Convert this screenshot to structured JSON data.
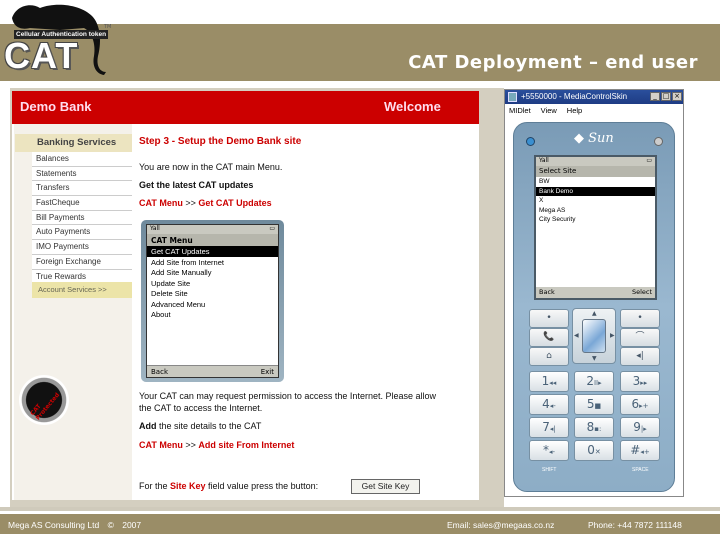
{
  "slide": {
    "title": "CAT Deployment – end user",
    "logo": {
      "tagline": "Cellular Authentication token",
      "wordmark": "CAT",
      "trademark": "TM"
    }
  },
  "bank": {
    "name": "Demo Bank",
    "welcome": "Welcome",
    "sidebar": {
      "heading": "Banking Services",
      "items": [
        {
          "label": "Balances"
        },
        {
          "label": "Statements"
        },
        {
          "label": "Transfers"
        },
        {
          "label": "FastCheque"
        },
        {
          "label": "Bill Payments"
        },
        {
          "label": "Auto Payments"
        },
        {
          "label": "IMO Payments"
        },
        {
          "label": "Foreign Exchange"
        },
        {
          "label": "True Rewards"
        }
      ],
      "footer_link": "Account Services  >>",
      "badge_text": "CAT Protected"
    },
    "content": {
      "step_title": "Step 3 - Setup the Demo Bank site",
      "intro": "You are now in the CAT main Menu.",
      "get_updates_heading": "Get the latest CAT updates",
      "path1_menu": "CAT Menu",
      "path1_sep": " >> ",
      "path1_target": "Get CAT Updates",
      "permission_line1": "Your CAT can may request permission to access the Internet. Please allow",
      "permission_line2": "the CAT to access the Internet.",
      "add_site_bold": "Add",
      "add_site_rest": " the site details to the CAT",
      "path2_menu": "CAT Menu",
      "path2_sep": " >> ",
      "path2_target": "Add site From Internet",
      "sitekey_prefix": "For the ",
      "sitekey_label": "Site Key",
      "sitekey_suffix": " field value press the button:",
      "sitekey_button": "Get Site Key"
    },
    "mini_phone": {
      "status_left": "Yall",
      "status_right": "▭",
      "title": "CAT Menu",
      "items": [
        {
          "label": "Get CAT Updates",
          "selected": true
        },
        {
          "label": "Add Site from Internet",
          "selected": false
        },
        {
          "label": "Add Site Manually",
          "selected": false
        },
        {
          "label": "Update Site",
          "selected": false
        },
        {
          "label": "Delete Site",
          "selected": false
        },
        {
          "label": "Advanced Menu",
          "selected": false
        },
        {
          "label": "About",
          "selected": false
        }
      ],
      "soft_left": "Back",
      "soft_right": "Exit"
    }
  },
  "emulator": {
    "window_title": "+5550000 - MediaControlSkin",
    "window_buttons": [
      "_",
      "□",
      "×"
    ],
    "menu": [
      "MIDlet",
      "View",
      "Help"
    ],
    "brand": "Sun",
    "screen": {
      "status_left": "Yall",
      "status_right": "▭",
      "title": "Select Site",
      "items": [
        {
          "label": "BW",
          "selected": false
        },
        {
          "label": "Bank Demo",
          "selected": true
        },
        {
          "label": "X",
          "selected": false
        },
        {
          "label": "Mega AS",
          "selected": false
        },
        {
          "label": "City Security",
          "selected": false
        }
      ],
      "soft_left": "Back",
      "soft_right": "Select"
    },
    "nav_keys": {
      "left": [
        "•",
        "📞",
        "⌂"
      ],
      "right": [
        "•",
        "⌒",
        "◂|"
      ]
    },
    "dpad_arrows": [
      "▲",
      "▼",
      "◀",
      "▶"
    ],
    "keypad": [
      {
        "digit": "1",
        "sub": "◂◂"
      },
      {
        "digit": "2",
        "sub": "II▸"
      },
      {
        "digit": "3",
        "sub": "▸▸"
      },
      {
        "digit": "4",
        "sub": "◂-"
      },
      {
        "digit": "5",
        "sub": "■"
      },
      {
        "digit": "6",
        "sub": "▸+"
      },
      {
        "digit": "7",
        "sub": "◂|"
      },
      {
        "digit": "8",
        "sub": "▪:"
      },
      {
        "digit": "9",
        "sub": "|▸"
      },
      {
        "digit": "*",
        "sub": "◂-"
      },
      {
        "digit": "0",
        "sub": "✕"
      },
      {
        "digit": "#",
        "sub": "◂+"
      }
    ],
    "key_captions": {
      "left": "SHIFT",
      "right": "SPACE"
    }
  },
  "footer": {
    "company": "Mega AS Consulting Ltd",
    "copyright_symbol": "©",
    "year": "2007",
    "email": "Email: sales@megaas.co.nz",
    "phone": "Phone: +44 7872 111148"
  },
  "colors": {
    "band": "#9a8d67",
    "bank_red": "#cc0000",
    "sidebar_highlight": "#ece4c0"
  }
}
